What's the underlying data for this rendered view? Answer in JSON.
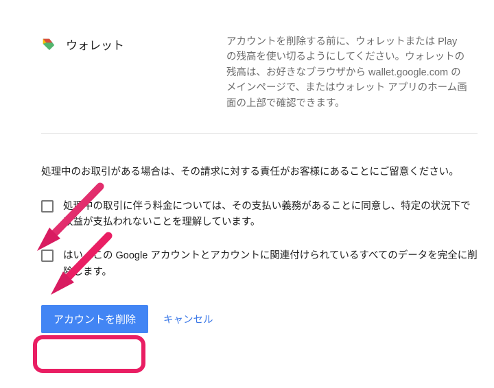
{
  "service": {
    "name": "ウォレット",
    "description": "アカウントを削除する前に、ウォレットまたは Play の残高を使い切るようにしてください。ウォレットの残高は、お好きなブラウザから wallet.google.com のメインページで、またはウォレット アプリのホーム画面の上部で確認できます。"
  },
  "notice": "処理中のお取引がある場合は、その請求に対する責任がお客様にあることにご留意ください。",
  "checkboxes": {
    "agree_fees": "処理中の取引に伴う料金については、その支払い義務があることに同意し、特定の状況下で収益が支払われないことを理解しています。",
    "confirm_delete": "はい、この Google アカウントとアカウントに関連付けられているすべてのデータを完全に削除します。"
  },
  "actions": {
    "delete_label": "アカウントを削除",
    "cancel_label": "キャンセル"
  },
  "colors": {
    "accent": "#4285f4",
    "annotation": "#e91e63"
  }
}
